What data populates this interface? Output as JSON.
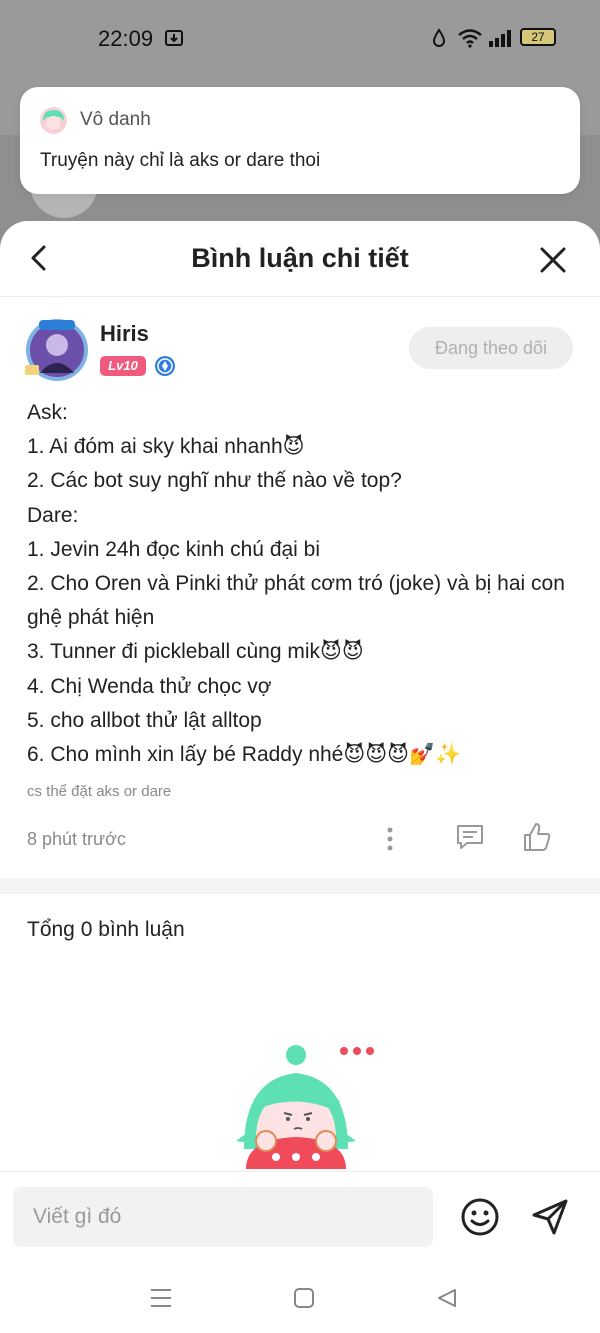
{
  "status_bar": {
    "time": "22:09",
    "battery": "27"
  },
  "notification": {
    "user": "Vô danh",
    "text": "Truyện này chỉ là aks or dare thoi"
  },
  "header": {
    "title": "Bình luận chi tiết"
  },
  "author": {
    "name": "Hiris",
    "level": "Lv10",
    "follow_label": "Đang theo dõi"
  },
  "comment": {
    "lines": [
      "Ask:",
      "1. Ai đóm ai sky khai nhanh😈",
      "2. Các bot suy nghĩ như thế nào về top?",
      "Dare:",
      "1. Jevin 24h đọc kinh chú đại bi",
      "2. Cho Oren và Pinki thử phát cơm tró (joke) và bị hai con ghệ phát hiện",
      "3. Tunner đi pickleball cùng mik😈😈",
      "4. Chị Wenda thử chọc vợ",
      "5. cho allbot thử lật alltop",
      "6. Cho mình xin lấy bé Raddy nhé😈😈😈💅✨"
    ],
    "note": "cs thể đặt aks or dare",
    "time": "8 phút trước"
  },
  "summary": {
    "total": "Tổng 0 bình luận"
  },
  "input": {
    "placeholder": "Viết gì đó"
  },
  "icons": {
    "back": "chevron-left-icon",
    "close": "close-icon",
    "more": "more-vertical-icon",
    "reply": "comment-icon",
    "like": "thumbs-up-icon",
    "emoji": "smiley-icon",
    "send": "send-icon"
  },
  "colors": {
    "level_badge": "#f05a7e",
    "follow_bg": "#eeeeee",
    "follow_text": "#b0b0b0",
    "illustration_hair": "#5ee0b5",
    "illustration_body": "#ef4b5a"
  }
}
